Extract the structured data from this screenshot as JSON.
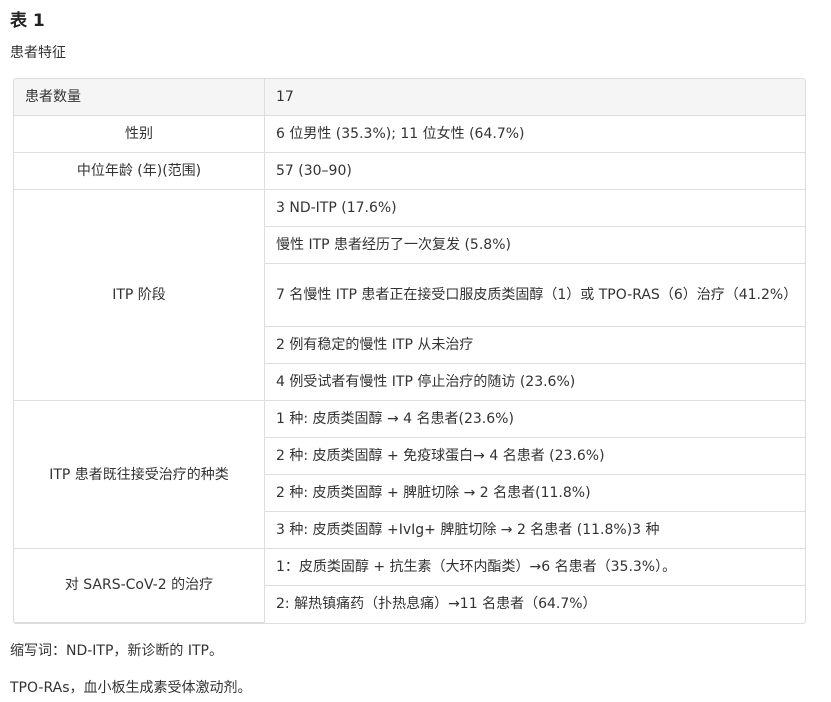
{
  "title": "表 1",
  "subtitle": "患者特征",
  "table": {
    "header": {
      "label": "患者数量",
      "value": "17"
    },
    "sex": {
      "label": "性别",
      "value": "6 位男性 (35.3%); 11 位女性 (64.7%)"
    },
    "age": {
      "label": "中位年龄 (年)(范围)",
      "value": "57 (30–90)"
    },
    "itp_stage": {
      "label": "ITP 阶段",
      "values": [
        "3 ND-ITP (17.6%)",
        "慢性 ITP 患者经历了一次复发 (5.8%)",
        "7 名慢性 ITP 患者正在接受口服皮质类固醇（1）或 TPO-RAS（6）治疗（41.2%）",
        "2 例有稳定的慢性 ITP 从未治疗",
        "4 例受试者有慢性 ITP 停止治疗的随访 (23.6%)"
      ]
    },
    "prior_treatment": {
      "label": "ITP 患者既往接受治疗的种类",
      "values": [
        "1 种: 皮质类固醇 → 4 名患者(23.6%)",
        "2 种: 皮质类固醇 + 免疫球蛋白→ 4 名患者 (23.6%)",
        "2 种: 皮质类固醇 + 脾脏切除 → 2 名患者(11.8%)",
        "3 种: 皮质类固醇 +IvIg+ 脾脏切除 → 2 名患者 (11.8%)3 种"
      ]
    },
    "covid_treatment": {
      "label": "对 SARS-CoV-2 的治疗",
      "values": [
        "1：皮质类固醇 + 抗生素（大环内酯类）→6 名患者（35.3%）。",
        "2: 解热镇痛药（扑热息痛）→11 名患者（64.7%）"
      ]
    }
  },
  "footnotes": [
    "缩写词：ND-ITP，新诊断的 ITP。",
    "TPO-RAs，血小板生成素受体激动剂。"
  ]
}
